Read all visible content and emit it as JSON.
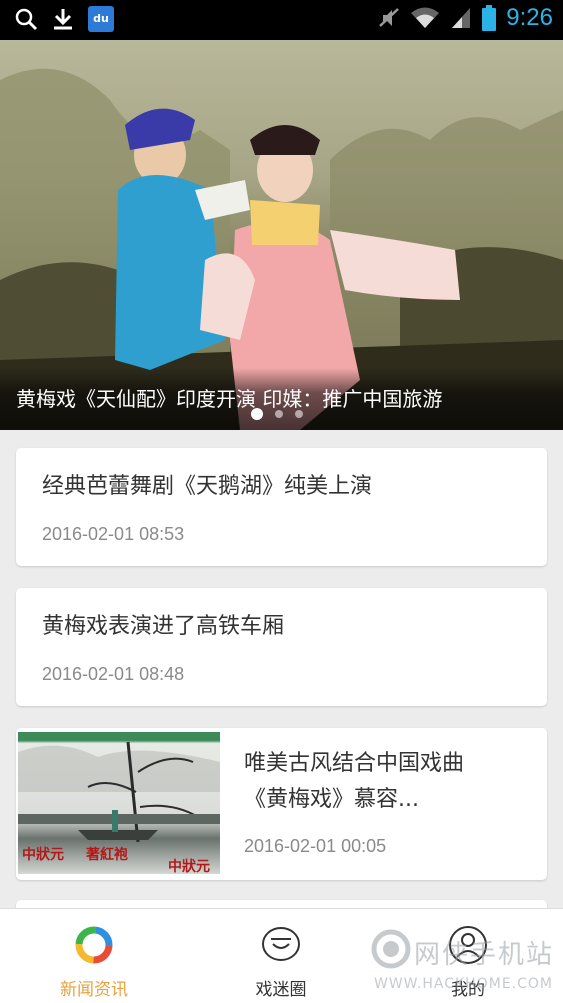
{
  "status_bar": {
    "time": "9:26",
    "left_icons": [
      "search-icon",
      "download-icon",
      "baidu-icon"
    ],
    "right_icons": [
      "mute-icon",
      "wifi-icon",
      "signal-icon",
      "battery-icon"
    ],
    "baidu_label": "du"
  },
  "banner": {
    "title": "黄梅戏《天仙配》印度开演 印媒：推广中国旅游",
    "dots": 3,
    "active_dot": 0
  },
  "news": [
    {
      "title": "经典芭蕾舞剧《天鹅湖》纯美上演",
      "time": "2016-02-01 08:53"
    },
    {
      "title": "黄梅戏表演进了高铁车厢",
      "time": "2016-02-01 08:48"
    },
    {
      "title": "唯美古风结合中国戏曲《黄梅戏》慕容...",
      "time": "2016-02-01 00:05",
      "thumb_text": [
        "中狀元",
        "著紅袍",
        "中狀元"
      ]
    }
  ],
  "bottom_nav": {
    "items": [
      {
        "label": "新闻资讯",
        "icon": "news-ring-icon",
        "active": true
      },
      {
        "label": "戏迷圈",
        "icon": "chat-bubble-icon",
        "active": false
      },
      {
        "label": "我的",
        "icon": "user-profile-icon",
        "active": false
      }
    ]
  },
  "watermark": {
    "text": "网侠手机站",
    "sub": "WWW.HACKHOME.COM"
  },
  "colors": {
    "status_time": "#2bb3e6",
    "active_tab": "#e6a23c",
    "background": "#ececec"
  }
}
